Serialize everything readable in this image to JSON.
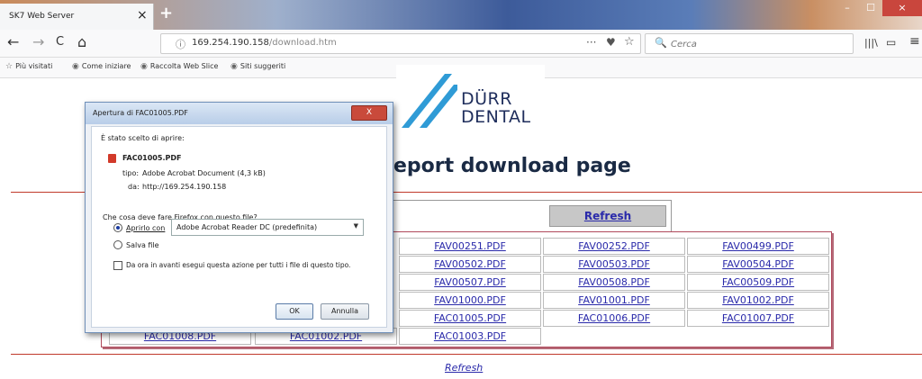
{
  "browser": {
    "tab_title": "SK7 Web Server",
    "tab_close": "×",
    "new_tab": "+",
    "window_controls": {
      "minimize": "–",
      "maximize": "☐",
      "close": "×"
    },
    "nav": {
      "back": "←",
      "forward": "→",
      "reload": "C",
      "home": "⌂"
    },
    "url_host": "169.254.190.158",
    "url_path": "/download.htm",
    "info_icon": "ⓘ",
    "more_icon": "···",
    "pocket_icon": "♥",
    "star_icon": "☆",
    "search_icon": "🔍",
    "search_placeholder": "Cerca",
    "library_icon": "|||\\",
    "sidebar_icon": "▭",
    "menu_icon": "≡",
    "bookmarks": [
      {
        "icon": "☆",
        "label": "Più visitati"
      },
      {
        "icon": "◉",
        "label": "Come iniziare"
      },
      {
        "icon": "◉",
        "label": "Raccolta Web Slice"
      },
      {
        "icon": "◉",
        "label": "Siti suggeriti"
      }
    ]
  },
  "page": {
    "logo_line1": "DÜRR",
    "logo_line2": "DENTAL",
    "heading": "eport download page",
    "refresh_button": "Refresh",
    "footer_refresh": "Refresh",
    "files": [
      [
        "",
        "",
        "FAV00251.PDF",
        "FAV00252.PDF",
        "FAV00499.PDF"
      ],
      [
        "",
        "",
        "FAV00502.PDF",
        "FAV00503.PDF",
        "FAV00504.PDF"
      ],
      [
        "",
        "",
        "FAV00507.PDF",
        "FAV00508.PDF",
        "FAC00509.PDF"
      ],
      [
        "",
        "",
        "FAV01000.PDF",
        "FAV01001.PDF",
        "FAV01002.PDF"
      ],
      [
        "",
        "",
        "FAC01005.PDF",
        "FAC01006.PDF",
        "FAC01007.PDF"
      ],
      [
        "FAC01008.PDF",
        "FAC01002.PDF",
        "FAC01003.PDF",
        "",
        ""
      ]
    ]
  },
  "dialog": {
    "title": "Apertura di FAC01005.PDF",
    "close": "X",
    "intro": "È stato scelto di aprire:",
    "file_name": "FAC01005.PDF",
    "type_label": "tipo:",
    "type_value": "Adobe Acrobat Document (4,3 kB)",
    "from_label": "da:",
    "from_value": "http://169.254.190.158",
    "question": "Che cosa deve fare Firefox con questo file?",
    "open_with_label": "Aprirlo con",
    "open_with_value": "Adobe Acrobat Reader DC  (predefinita)",
    "save_label": "Salva file",
    "remember_label": "Da ora in avanti esegui questa azione per tutti i file di questo tipo.",
    "ok_label": "OK",
    "cancel_label": "Annulla"
  }
}
